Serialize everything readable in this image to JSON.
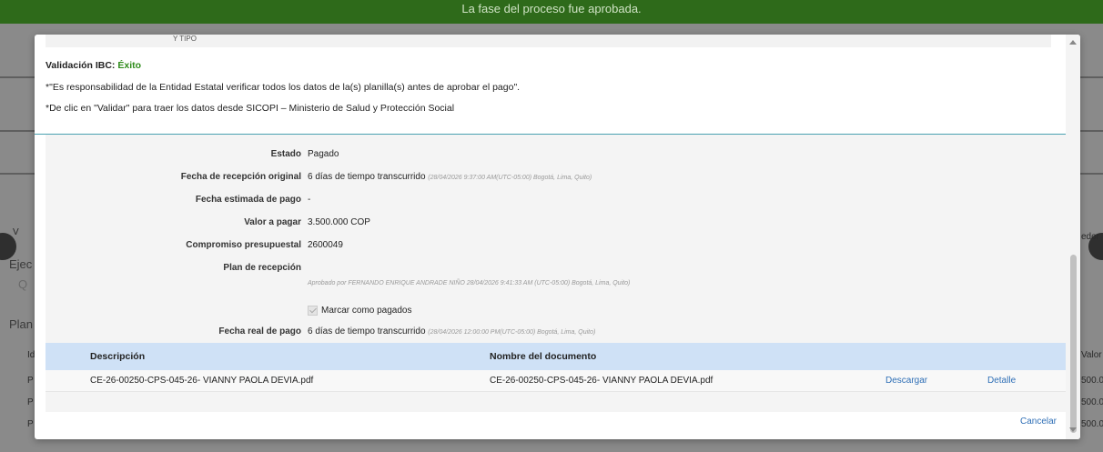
{
  "background": {
    "banner": "La fase del proceso fue aprobada.",
    "left_labels": [
      "V",
      "Ejec",
      "Q",
      "Plan",
      "Id",
      "P",
      "P",
      "P"
    ],
    "right_labels": [
      "edor",
      "Valor",
      "500.0",
      "500.0",
      "500.0"
    ]
  },
  "modal": {
    "top_cut_text": "Y TIPO",
    "validation_label": "Validación IBC:",
    "validation_status": "Éxito",
    "responsibility_note": "*\"Es responsabilidad de la Entidad Estatal verificar todos los datos de la(s) planilla(s) antes de aprobar el pago\".",
    "sicopi_note": "*De clic en \"Validar\" para traer los datos desde SICOPI – Ministerio de Salud y Protección Social",
    "fields": {
      "estado": {
        "label": "Estado",
        "value": "Pagado"
      },
      "fecha_recepcion": {
        "label": "Fecha de recepción original",
        "value": "6 días de tiempo transcurrido",
        "timestamp": "(28/04/2026 9:37:00 AM(UTC-05:00) Bogotá, Lima, Quito)"
      },
      "fecha_estimada": {
        "label": "Fecha estimada de pago",
        "value": "-"
      },
      "valor": {
        "label": "Valor a pagar",
        "value": "3.500.000 COP"
      },
      "compromiso": {
        "label": "Compromiso presupuestal",
        "value": "2600049"
      },
      "plan": {
        "label": "Plan de recepción",
        "approved_by": "Aprobado por FERNANDO ENRIQUE ANDRADE NIÑO 28/04/2026 9:41:33 AM (UTC-05:00) Bogotá, Lima, Quito)"
      },
      "marcar_pagados": {
        "label": "Marcar como pagados",
        "checked": true
      },
      "fecha_real": {
        "label": "Fecha real de pago",
        "value": "6 días de tiempo transcurrido",
        "timestamp": "(28/04/2026 12:00:00 PM(UTC-05:00) Bogotá, Lima, Quito)"
      }
    },
    "documents": {
      "headers": {
        "descripcion": "Descripción",
        "nombre": "Nombre del documento"
      },
      "rows": [
        {
          "descripcion": "CE-26-00250-CPS-045-26- VIANNY PAOLA DEVIA.pdf",
          "nombre": "CE-26-00250-CPS-045-26- VIANNY PAOLA DEVIA.pdf",
          "descargar": "Descargar",
          "detalle": "Detalle"
        }
      ]
    },
    "cancel_label": "Cancelar"
  },
  "colors": {
    "accent_link": "#2f6fb6",
    "success": "#2e8b1a",
    "table_header": "#cfe1f6",
    "banner": "#2e6a1a"
  }
}
